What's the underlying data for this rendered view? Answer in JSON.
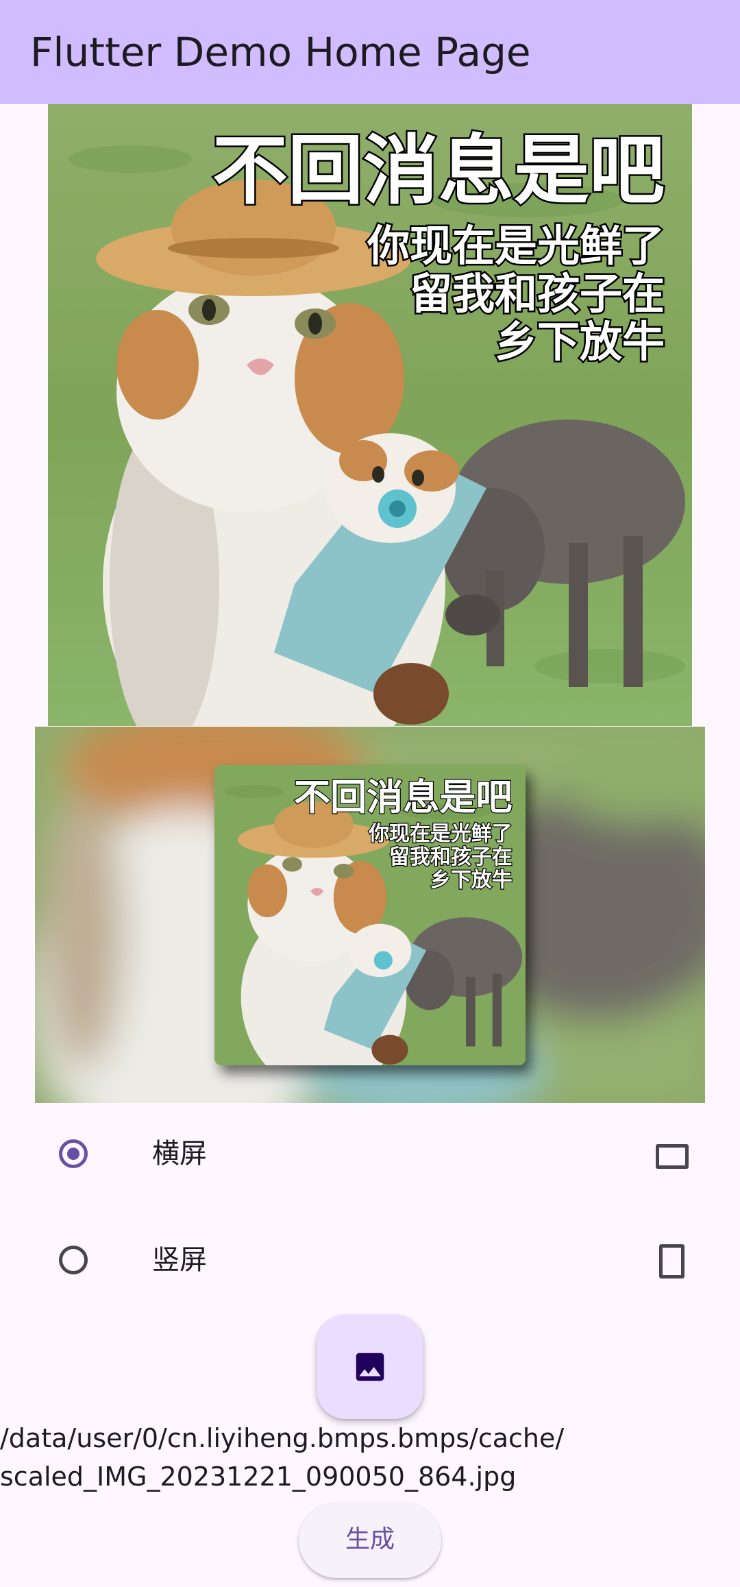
{
  "app_bar": {
    "title": "Flutter Demo Home Page"
  },
  "original_image": {
    "description_icon": "cat-meme-image",
    "caption_title": "不回消息是吧",
    "caption_line1": "你现在是光鲜了",
    "caption_line2": "留我和孩子在",
    "caption_line3": "乡下放牛"
  },
  "preview": {
    "caption_title": "不回消息是吧",
    "caption_line1": "你现在是光鲜了",
    "caption_line2": "留我和孩子在",
    "caption_line3": "乡下放牛"
  },
  "orientation_options": [
    {
      "label": "横屏",
      "selected": true,
      "icon": "crop-landscape-icon"
    },
    {
      "label": "竖屏",
      "selected": false,
      "icon": "crop-portrait-icon"
    }
  ],
  "fab": {
    "icon": "image-icon"
  },
  "file_path": {
    "line1": "/data/user/0/cn.liyiheng.bmps.bmps/cache/",
    "line2": "scaled_IMG_20231221_090050_864.jpg"
  },
  "generate_button": {
    "label": "生成"
  },
  "colors": {
    "app_bar": "#d0bcff",
    "background": "#fef7ff",
    "primary": "#6750a4",
    "fab": "#eaddff"
  }
}
